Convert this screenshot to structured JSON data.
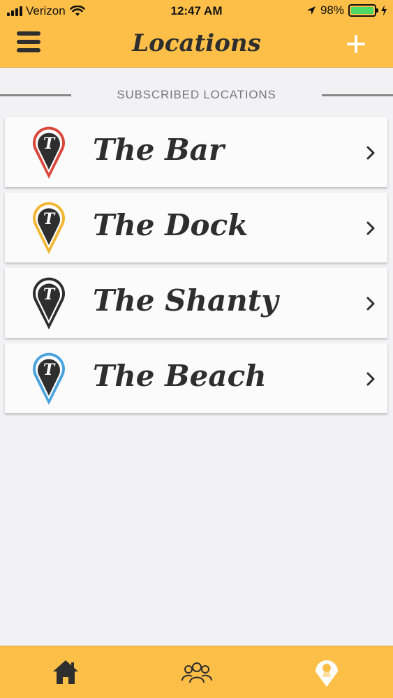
{
  "status_bar": {
    "carrier": "Verizon",
    "time": "12:47 AM",
    "battery": "98%"
  },
  "header": {
    "title": "Locations"
  },
  "section": {
    "label": "SUBSCRIBED LOCATIONS"
  },
  "locations": [
    {
      "name": "The Bar",
      "pin_color": "#d9473b"
    },
    {
      "name": "The Dock",
      "pin_color": "#f2b632"
    },
    {
      "name": "The Shanty",
      "pin_color": "#2e2e2e"
    },
    {
      "name": "The Beach",
      "pin_color": "#4aa3df"
    }
  ],
  "pin_letter": "T",
  "tabbar": {
    "tabs": [
      {
        "icon": "home-icon",
        "active": false
      },
      {
        "icon": "people-icon",
        "active": false
      },
      {
        "icon": "map-pin-icon",
        "active": true
      }
    ]
  },
  "colors": {
    "brand": "#fdbf48",
    "text": "#2e2e2e"
  }
}
